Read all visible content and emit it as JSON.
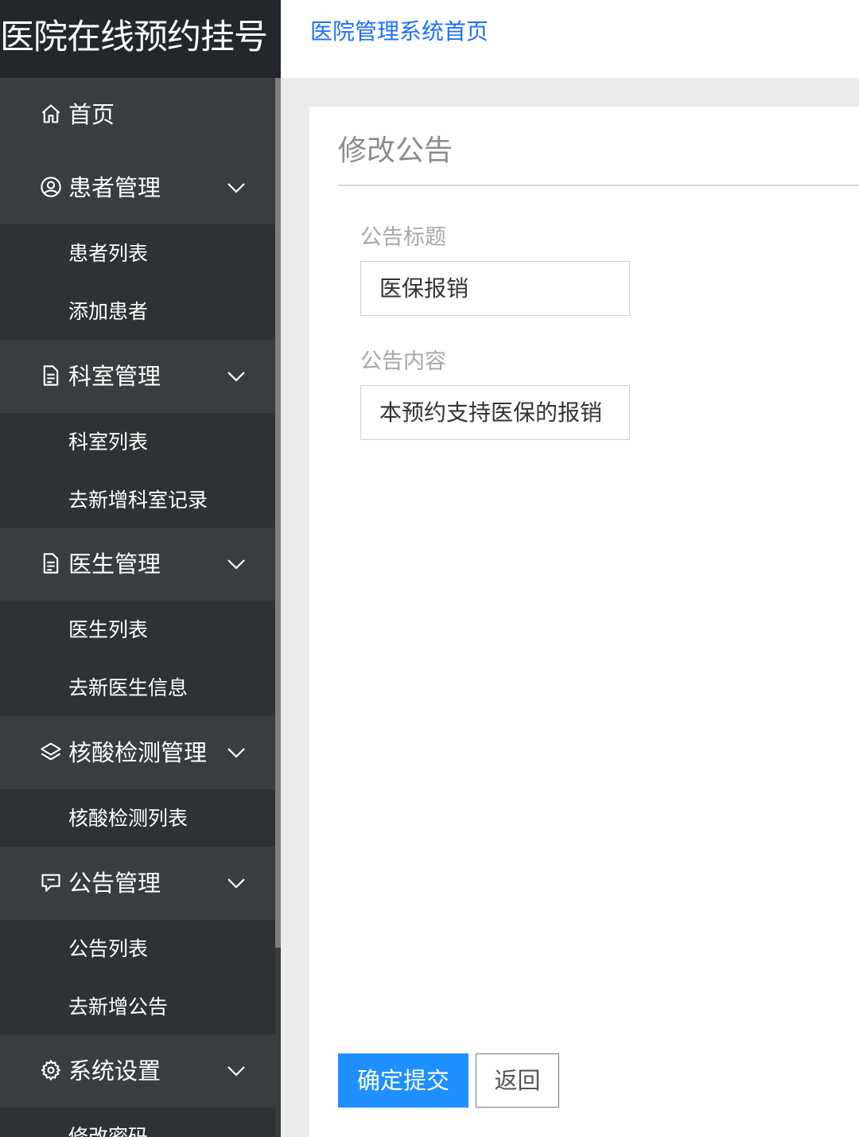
{
  "app": {
    "brand": "医院在线预约挂号",
    "header_link": "医院管理系统首页"
  },
  "sidebar": {
    "home": "首页",
    "groups": [
      {
        "label": "患者管理",
        "icon": "user-circle-icon",
        "items": [
          "患者列表",
          "添加患者"
        ]
      },
      {
        "label": "科室管理",
        "icon": "document-icon",
        "items": [
          "科室列表",
          "去新增科室记录"
        ]
      },
      {
        "label": "医生管理",
        "icon": "document-icon",
        "items": [
          "医生列表",
          "去新医生信息"
        ]
      },
      {
        "label": "核酸检测管理",
        "icon": "layers-icon",
        "items": [
          "核酸检测列表"
        ]
      },
      {
        "label": "公告管理",
        "icon": "notice-icon",
        "items": [
          "公告列表",
          "去新增公告"
        ]
      },
      {
        "label": "系统设置",
        "icon": "gear-icon",
        "items": [
          "修改密码"
        ]
      }
    ]
  },
  "main": {
    "page_title": "修改公告",
    "form": {
      "title_label": "公告标题",
      "title_value": "医保报销",
      "content_label": "公告内容",
      "content_value": "本预约支持医保的报销"
    },
    "buttons": {
      "submit": "确定提交",
      "back": "返回"
    }
  },
  "colors": {
    "sidebar_bg": "#393d3f",
    "sidebar_sub_bg": "#2f3234",
    "brand_bg": "#23262b",
    "accent": "#1e90ff",
    "link": "#1e6fff"
  }
}
